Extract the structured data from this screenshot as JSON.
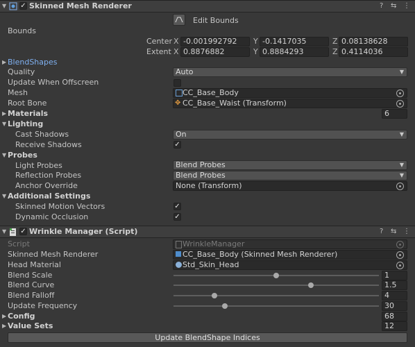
{
  "skinned_mesh_renderer": {
    "title": "Skinned Mesh Renderer",
    "enabled_check": "✓",
    "edit_bounds_label": "Edit Bounds",
    "bounds_label": "Bounds",
    "center_label": "Center",
    "extent_label": "Extent",
    "center": {
      "x": "-0.001992792",
      "y": "-0.1417035",
      "z": "0.08138628"
    },
    "extent": {
      "x": "0.8876882",
      "y": "0.8884293",
      "z": "0.4114036"
    },
    "axis_x": "X",
    "axis_y": "Y",
    "axis_z": "Z",
    "blendshapes_label": "BlendShapes",
    "quality_label": "Quality",
    "quality_value": "Auto",
    "update_offscreen_label": "Update When Offscreen",
    "mesh_label": "Mesh",
    "mesh_value": "CC_Base_Body",
    "root_bone_label": "Root Bone",
    "root_bone_value": "CC_Base_Waist (Transform)",
    "materials_label": "Materials",
    "materials_count": "6",
    "lighting_label": "Lighting",
    "cast_shadows_label": "Cast Shadows",
    "cast_shadows_value": "On",
    "receive_shadows_label": "Receive Shadows",
    "receive_shadows_check": "✓",
    "probes_label": "Probes",
    "light_probes_label": "Light Probes",
    "light_probes_value": "Blend Probes",
    "reflection_probes_label": "Reflection Probes",
    "reflection_probes_value": "Blend Probes",
    "anchor_override_label": "Anchor Override",
    "anchor_override_value": "None (Transform)",
    "additional_settings_label": "Additional Settings",
    "skinned_motion_vectors_label": "Skinned Motion Vectors",
    "skinned_motion_vectors_check": "✓",
    "dynamic_occlusion_label": "Dynamic Occlusion",
    "dynamic_occlusion_check": "✓"
  },
  "wrinkle_manager": {
    "title": "Wrinkle Manager (Script)",
    "enabled_check": "✓",
    "script_label": "Script",
    "script_value": "WrinkleManager",
    "smr_label": "Skinned Mesh Renderer",
    "smr_value": "CC_Base_Body (Skinned Mesh Renderer)",
    "head_material_label": "Head Material",
    "head_material_value": "Std_Skin_Head",
    "blend_scale_label": "Blend Scale",
    "blend_scale_value": "1",
    "blend_scale_fraction": 0.5,
    "blend_curve_label": "Blend Curve",
    "blend_curve_value": "1.5",
    "blend_curve_fraction": 0.67,
    "blend_falloff_label": "Blend Falloff",
    "blend_falloff_value": "4",
    "blend_falloff_fraction": 0.2,
    "update_frequency_label": "Update Frequency",
    "update_frequency_value": "30",
    "update_frequency_fraction": 0.25,
    "config_label": "Config",
    "config_count": "68",
    "value_sets_label": "Value Sets",
    "value_sets_count": "12",
    "update_button_label": "Update BlendShape Indices"
  },
  "header_icons": {
    "help": "help-icon",
    "preset": "preset-sliders-icon",
    "menu": "kebab-menu-icon"
  },
  "colors": {
    "link": "#7fb0f0",
    "background": "#383838",
    "field": "#2a2a2a"
  }
}
